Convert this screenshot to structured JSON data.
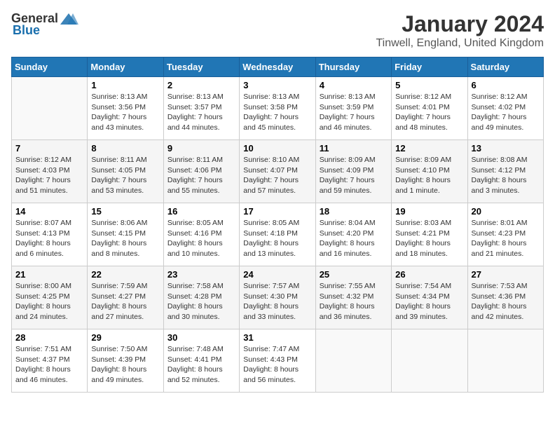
{
  "logo": {
    "general": "General",
    "blue": "Blue"
  },
  "title": "January 2024",
  "location": "Tinwell, England, United Kingdom",
  "weekdays": [
    "Sunday",
    "Monday",
    "Tuesday",
    "Wednesday",
    "Thursday",
    "Friday",
    "Saturday"
  ],
  "weeks": [
    [
      {
        "day": "",
        "info": ""
      },
      {
        "day": "1",
        "info": "Sunrise: 8:13 AM\nSunset: 3:56 PM\nDaylight: 7 hours\nand 43 minutes."
      },
      {
        "day": "2",
        "info": "Sunrise: 8:13 AM\nSunset: 3:57 PM\nDaylight: 7 hours\nand 44 minutes."
      },
      {
        "day": "3",
        "info": "Sunrise: 8:13 AM\nSunset: 3:58 PM\nDaylight: 7 hours\nand 45 minutes."
      },
      {
        "day": "4",
        "info": "Sunrise: 8:13 AM\nSunset: 3:59 PM\nDaylight: 7 hours\nand 46 minutes."
      },
      {
        "day": "5",
        "info": "Sunrise: 8:12 AM\nSunset: 4:01 PM\nDaylight: 7 hours\nand 48 minutes."
      },
      {
        "day": "6",
        "info": "Sunrise: 8:12 AM\nSunset: 4:02 PM\nDaylight: 7 hours\nand 49 minutes."
      }
    ],
    [
      {
        "day": "7",
        "info": "Sunrise: 8:12 AM\nSunset: 4:03 PM\nDaylight: 7 hours\nand 51 minutes."
      },
      {
        "day": "8",
        "info": "Sunrise: 8:11 AM\nSunset: 4:05 PM\nDaylight: 7 hours\nand 53 minutes."
      },
      {
        "day": "9",
        "info": "Sunrise: 8:11 AM\nSunset: 4:06 PM\nDaylight: 7 hours\nand 55 minutes."
      },
      {
        "day": "10",
        "info": "Sunrise: 8:10 AM\nSunset: 4:07 PM\nDaylight: 7 hours\nand 57 minutes."
      },
      {
        "day": "11",
        "info": "Sunrise: 8:09 AM\nSunset: 4:09 PM\nDaylight: 7 hours\nand 59 minutes."
      },
      {
        "day": "12",
        "info": "Sunrise: 8:09 AM\nSunset: 4:10 PM\nDaylight: 8 hours\nand 1 minute."
      },
      {
        "day": "13",
        "info": "Sunrise: 8:08 AM\nSunset: 4:12 PM\nDaylight: 8 hours\nand 3 minutes."
      }
    ],
    [
      {
        "day": "14",
        "info": "Sunrise: 8:07 AM\nSunset: 4:13 PM\nDaylight: 8 hours\nand 6 minutes."
      },
      {
        "day": "15",
        "info": "Sunrise: 8:06 AM\nSunset: 4:15 PM\nDaylight: 8 hours\nand 8 minutes."
      },
      {
        "day": "16",
        "info": "Sunrise: 8:05 AM\nSunset: 4:16 PM\nDaylight: 8 hours\nand 10 minutes."
      },
      {
        "day": "17",
        "info": "Sunrise: 8:05 AM\nSunset: 4:18 PM\nDaylight: 8 hours\nand 13 minutes."
      },
      {
        "day": "18",
        "info": "Sunrise: 8:04 AM\nSunset: 4:20 PM\nDaylight: 8 hours\nand 16 minutes."
      },
      {
        "day": "19",
        "info": "Sunrise: 8:03 AM\nSunset: 4:21 PM\nDaylight: 8 hours\nand 18 minutes."
      },
      {
        "day": "20",
        "info": "Sunrise: 8:01 AM\nSunset: 4:23 PM\nDaylight: 8 hours\nand 21 minutes."
      }
    ],
    [
      {
        "day": "21",
        "info": "Sunrise: 8:00 AM\nSunset: 4:25 PM\nDaylight: 8 hours\nand 24 minutes."
      },
      {
        "day": "22",
        "info": "Sunrise: 7:59 AM\nSunset: 4:27 PM\nDaylight: 8 hours\nand 27 minutes."
      },
      {
        "day": "23",
        "info": "Sunrise: 7:58 AM\nSunset: 4:28 PM\nDaylight: 8 hours\nand 30 minutes."
      },
      {
        "day": "24",
        "info": "Sunrise: 7:57 AM\nSunset: 4:30 PM\nDaylight: 8 hours\nand 33 minutes."
      },
      {
        "day": "25",
        "info": "Sunrise: 7:55 AM\nSunset: 4:32 PM\nDaylight: 8 hours\nand 36 minutes."
      },
      {
        "day": "26",
        "info": "Sunrise: 7:54 AM\nSunset: 4:34 PM\nDaylight: 8 hours\nand 39 minutes."
      },
      {
        "day": "27",
        "info": "Sunrise: 7:53 AM\nSunset: 4:36 PM\nDaylight: 8 hours\nand 42 minutes."
      }
    ],
    [
      {
        "day": "28",
        "info": "Sunrise: 7:51 AM\nSunset: 4:37 PM\nDaylight: 8 hours\nand 46 minutes."
      },
      {
        "day": "29",
        "info": "Sunrise: 7:50 AM\nSunset: 4:39 PM\nDaylight: 8 hours\nand 49 minutes."
      },
      {
        "day": "30",
        "info": "Sunrise: 7:48 AM\nSunset: 4:41 PM\nDaylight: 8 hours\nand 52 minutes."
      },
      {
        "day": "31",
        "info": "Sunrise: 7:47 AM\nSunset: 4:43 PM\nDaylight: 8 hours\nand 56 minutes."
      },
      {
        "day": "",
        "info": ""
      },
      {
        "day": "",
        "info": ""
      },
      {
        "day": "",
        "info": ""
      }
    ]
  ]
}
